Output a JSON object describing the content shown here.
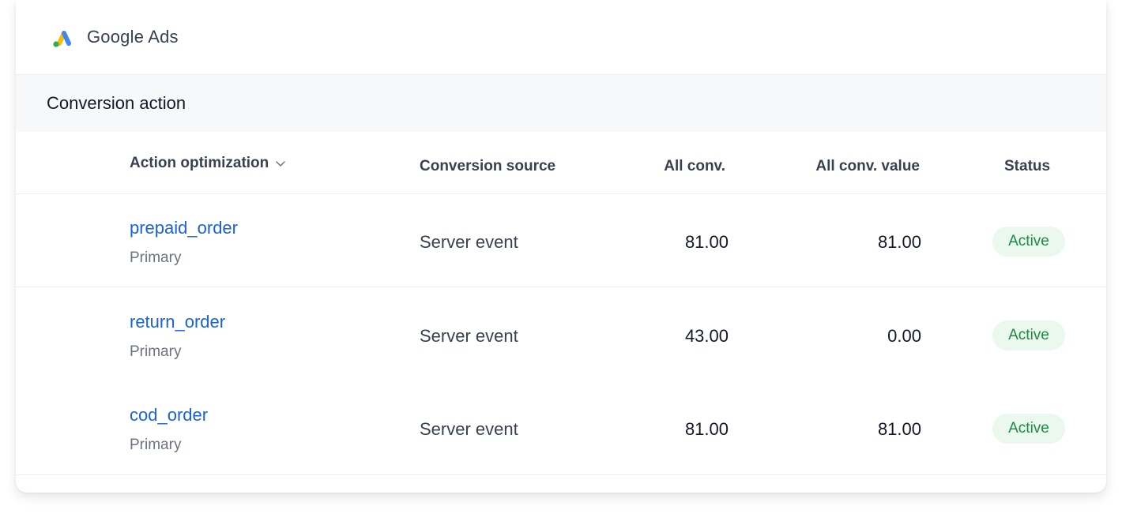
{
  "brand": {
    "name": "Google Ads",
    "logo_icon": "google-ads-logo-icon",
    "logo_colors": [
      "#fbbc04",
      "#4285f4",
      "#34a853"
    ]
  },
  "section": {
    "title": "Conversion action"
  },
  "table": {
    "headers": {
      "optimization": "Action optimization",
      "source": "Conversion source",
      "all_conv": "All conv.",
      "all_conv_value": "All conv. value",
      "status": "Status"
    },
    "sort_icon": "chevron-down-icon",
    "rows": [
      {
        "name": "prepaid_order",
        "type": "Primary",
        "source": "Server event",
        "all_conv": "81.00",
        "all_conv_value": "81.00",
        "status": "Active"
      },
      {
        "name": "return_order",
        "type": "Primary",
        "source": "Server event",
        "all_conv": "43.00",
        "all_conv_value": "0.00",
        "status": "Active"
      },
      {
        "name": "cod_order",
        "type": "Primary",
        "source": "Server event",
        "all_conv": "81.00",
        "all_conv_value": "81.00",
        "status": "Active"
      }
    ]
  },
  "colors": {
    "link": "#1a62d9",
    "status_text": "#1c8a3f",
    "status_bg": "#eaf8ee",
    "section_bg": "#f7f8fa"
  }
}
